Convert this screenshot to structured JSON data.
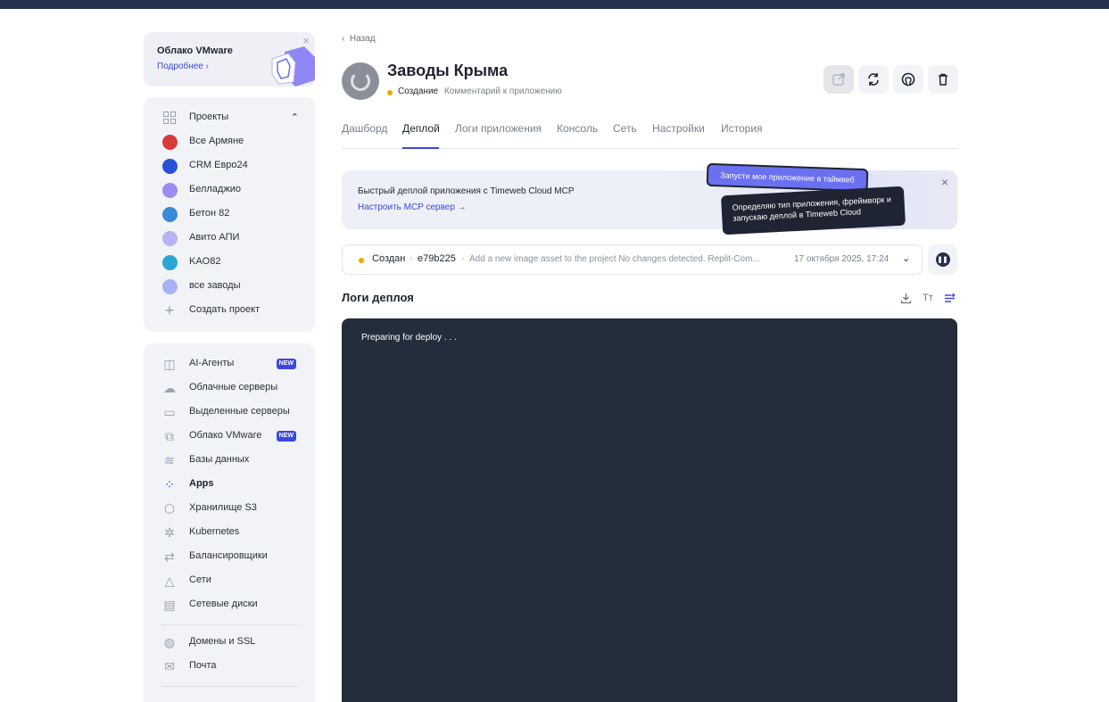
{
  "promo": {
    "title": "Облако VMware",
    "link": "Подробнее",
    "close": "×"
  },
  "projects": {
    "header": "Проекты",
    "items": [
      {
        "label": "Все Армяне",
        "color": "#d83a3a"
      },
      {
        "label": "CRM Евро24",
        "color": "#2a4fd8"
      },
      {
        "label": "Белладжио",
        "color": "#9b8cf2"
      },
      {
        "label": "Бетон 82",
        "color": "#3a8ad8"
      },
      {
        "label": "Авито АПИ",
        "color": "#b8b3f0"
      },
      {
        "label": "KAO82",
        "color": "#2aa6d0"
      },
      {
        "label": "все заводы",
        "color": "#a8b2f5"
      }
    ],
    "create": "Создать проект"
  },
  "services": {
    "items": [
      {
        "label": "AI-Агенты",
        "badge": "NEW",
        "icon": "robot-icon"
      },
      {
        "label": "Облачные серверы",
        "icon": "cloud-icon"
      },
      {
        "label": "Выделенные серверы",
        "icon": "server-icon"
      },
      {
        "label": "Облако VMware",
        "badge": "NEW",
        "icon": "vmware-icon"
      },
      {
        "label": "Базы данных",
        "icon": "database-icon"
      },
      {
        "label": "Apps",
        "icon": "apps-icon",
        "active": true
      },
      {
        "label": "Хранилище S3",
        "icon": "box-icon"
      },
      {
        "label": "Kubernetes",
        "icon": "kubernetes-icon"
      },
      {
        "label": "Балансировщики",
        "icon": "balancer-icon"
      },
      {
        "label": "Сети",
        "icon": "network-icon"
      },
      {
        "label": "Сетевые диски",
        "icon": "disk-icon"
      },
      {
        "label": "Домены и SSL",
        "icon": "globe-icon"
      },
      {
        "label": "Почта",
        "icon": "mail-icon"
      }
    ]
  },
  "header": {
    "back": "Назад",
    "title": "Заводы Крыма",
    "status": "Создание",
    "comment": "Комментарий к приложению"
  },
  "tabs": [
    "Дашборд",
    "Деплой",
    "Логи приложения",
    "Консоль",
    "Сеть",
    "Настройки",
    "История"
  ],
  "mcp": {
    "title": "Быстрый деплой приложения с Timeweb Cloud MCP",
    "link": "Настроить MCP сервер →",
    "bubble1": "Запусти мое приложение в таймвеб",
    "bubble2": "Определяю тип приложения, фреймворк и запускаю деплой в Timeweb Cloud"
  },
  "deploy": {
    "status": "Создан",
    "hash": "e79b225",
    "message": "Add a new image asset to the project No changes detected. Replit-Com...",
    "date": "17 октября 2025, 17:24"
  },
  "logs": {
    "title": "Логи деплоя",
    "font_tool": "Тт",
    "line": "Preparing for deploy . . ."
  },
  "colors": {
    "accent": "#3b48e0",
    "status_pending": "#f0a500",
    "console_bg": "#232d3b"
  }
}
